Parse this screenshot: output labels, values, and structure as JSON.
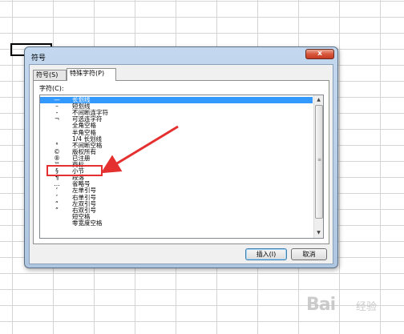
{
  "dialog": {
    "title": "符号",
    "close_label": "x",
    "tabs": [
      {
        "label": "符号(S)"
      },
      {
        "label": "特殊字符(P)"
      }
    ],
    "field_label": "字符(C):",
    "items": [
      {
        "symbol": "—",
        "label": "长划线",
        "selected": true
      },
      {
        "symbol": "–",
        "label": "短划线"
      },
      {
        "symbol": "‐",
        "label": "不间断连字符"
      },
      {
        "symbol": "¬",
        "label": "可选连字符"
      },
      {
        "symbol": "",
        "label": "全角空格"
      },
      {
        "symbol": "",
        "label": "半角空格"
      },
      {
        "symbol": "",
        "label": "1/4 长划线"
      },
      {
        "symbol": "°",
        "label": "不间断空格"
      },
      {
        "symbol": "©",
        "label": "版权所有"
      },
      {
        "symbol": "®",
        "label": "已注册"
      },
      {
        "symbol": "™",
        "label": "商标"
      },
      {
        "symbol": "§",
        "label": "小节"
      },
      {
        "symbol": "¶",
        "label": "段落"
      },
      {
        "symbol": "…",
        "label": "省略号"
      },
      {
        "symbol": "‘",
        "label": "左单引号"
      },
      {
        "symbol": "’",
        "label": "右单引号"
      },
      {
        "symbol": "“",
        "label": "左双引号"
      },
      {
        "symbol": "”",
        "label": "右双引号"
      },
      {
        "symbol": "",
        "label": "短空格"
      },
      {
        "symbol": "",
        "label": "零宽度空格"
      }
    ],
    "insert_label": "插入(I)",
    "cancel_label": "取消"
  },
  "colors": {
    "selection": "#3399ff",
    "highlight": "#e53030",
    "close_button": "#d8573c"
  },
  "watermark": {
    "brand": "Bai",
    "suffix": "经验"
  }
}
